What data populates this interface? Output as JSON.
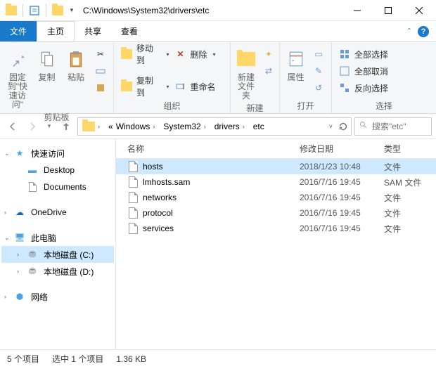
{
  "title": "C:\\Windows\\System32\\drivers\\etc",
  "tabs": {
    "file": "文件",
    "home": "主页",
    "share": "共享",
    "view": "查看"
  },
  "ribbon": {
    "pin": "固定到\"快\n速访问\"",
    "copy": "复制",
    "paste": "粘贴",
    "moveto": "移动到",
    "copyto": "复制到",
    "delete": "删除",
    "rename": "重命名",
    "newfolder": "新建\n文件夹",
    "props": "属性",
    "selectall": "全部选择",
    "selectnone": "全部取消",
    "invert": "反向选择",
    "g_clip": "剪贴板",
    "g_org": "组织",
    "g_new": "新建",
    "g_open": "打开",
    "g_sel": "选择"
  },
  "crumbs": [
    "Windows",
    "System32",
    "drivers",
    "etc"
  ],
  "search_ph": "搜索\"etc\"",
  "columns": {
    "name": "名称",
    "date": "修改日期",
    "type": "类型"
  },
  "nav": {
    "quick": "快速访问",
    "desktop": "Desktop",
    "docs": "Documents",
    "onedrive": "OneDrive",
    "pc": "此电脑",
    "cdrive": "本地磁盘 (C:)",
    "ddrive": "本地磁盘 (D:)",
    "network": "网络"
  },
  "files": [
    {
      "name": "hosts",
      "date": "2018/1/23 10:48",
      "type": "文件",
      "sel": true
    },
    {
      "name": "lmhosts.sam",
      "date": "2016/7/16 19:45",
      "type": "SAM 文件"
    },
    {
      "name": "networks",
      "date": "2016/7/16 19:45",
      "type": "文件"
    },
    {
      "name": "protocol",
      "date": "2016/7/16 19:45",
      "type": "文件"
    },
    {
      "name": "services",
      "date": "2016/7/16 19:45",
      "type": "文件"
    }
  ],
  "status": {
    "items": "5 个项目",
    "sel": "选中 1 个项目",
    "size": "1.36 KB"
  }
}
